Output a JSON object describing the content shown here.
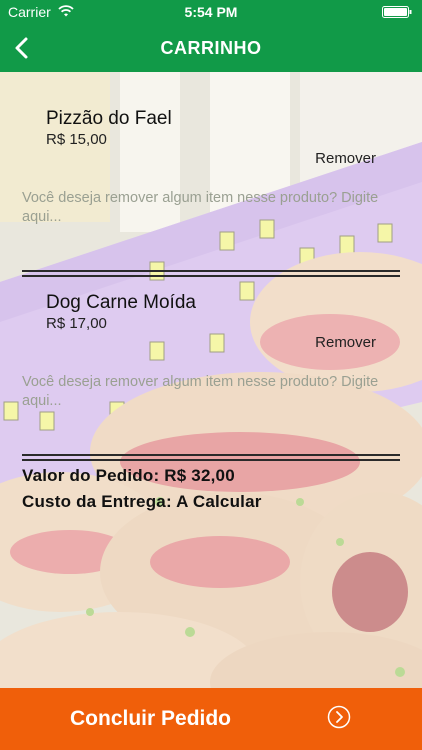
{
  "status_bar": {
    "carrier": "Carrier",
    "time": "5:54 PM"
  },
  "nav": {
    "title": "CARRINHO"
  },
  "cart_items": [
    {
      "name": "Pizzão do Fael",
      "price": "R$ 15,00",
      "remove_label": "Remover",
      "note_placeholder": "Você deseja remover algum item nesse produto? Digite aqui..."
    },
    {
      "name": "Dog Carne Moída",
      "price": "R$ 17,00",
      "remove_label": "Remover",
      "note_placeholder": "Você deseja remover algum item nesse produto? Digite aqui..."
    }
  ],
  "summary": {
    "order_value": "Valor do Pedido: R$ 32,00",
    "delivery_cost": "Custo da Entrega: A Calcular"
  },
  "footer": {
    "conclude_label": "Concluir Pedido"
  },
  "colors": {
    "brand_green": "#119a48",
    "action_orange": "#f05f0a"
  },
  "icons": [
    "wifi-icon",
    "battery-icon",
    "back-chevron-icon",
    "arrow-right-circle-icon"
  ]
}
